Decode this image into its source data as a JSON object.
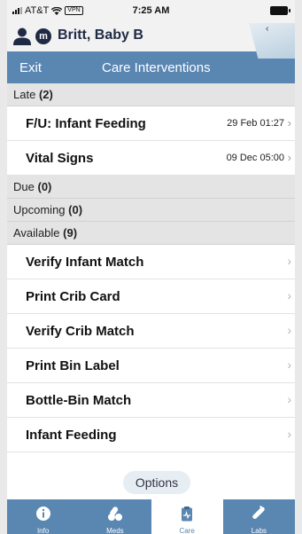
{
  "status_bar": {
    "carrier": "AT&T",
    "vpn": "VPN",
    "time": "7:25 AM"
  },
  "patient": {
    "badge": "m",
    "name": "Britt, Baby B"
  },
  "side_tab": {
    "icon": "chevron-left-icon"
  },
  "nav": {
    "exit_label": "Exit",
    "title": "Care Interventions"
  },
  "sections": {
    "late": {
      "label": "Late",
      "count": "(2)"
    },
    "due": {
      "label": "Due",
      "count": "(0)"
    },
    "upcoming": {
      "label": "Upcoming",
      "count": "(0)"
    },
    "available": {
      "label": "Available",
      "count": "(9)"
    }
  },
  "late_items": [
    {
      "label": "F/U: Infant Feeding",
      "date": "29 Feb 01:27"
    },
    {
      "label": "Vital Signs",
      "date": "09 Dec 05:00"
    }
  ],
  "available_items": [
    {
      "label": "Verify Infant Match"
    },
    {
      "label": "Print Crib Card"
    },
    {
      "label": "Verify Crib Match"
    },
    {
      "label": "Print Bin Label"
    },
    {
      "label": "Bottle-Bin Match"
    },
    {
      "label": "Infant Feeding"
    }
  ],
  "options_label": "Options",
  "tabs": [
    {
      "label": "Info",
      "icon": "info-icon",
      "active": false
    },
    {
      "label": "Meds",
      "icon": "pills-icon",
      "active": false
    },
    {
      "label": "Care",
      "icon": "clipboard-icon",
      "active": true
    },
    {
      "label": "Labs",
      "icon": "test-tube-icon",
      "active": false
    }
  ],
  "colors": {
    "accent": "#5a86b2",
    "section_bg": "#e4e4e4",
    "patient_name": "#1f2a44"
  }
}
